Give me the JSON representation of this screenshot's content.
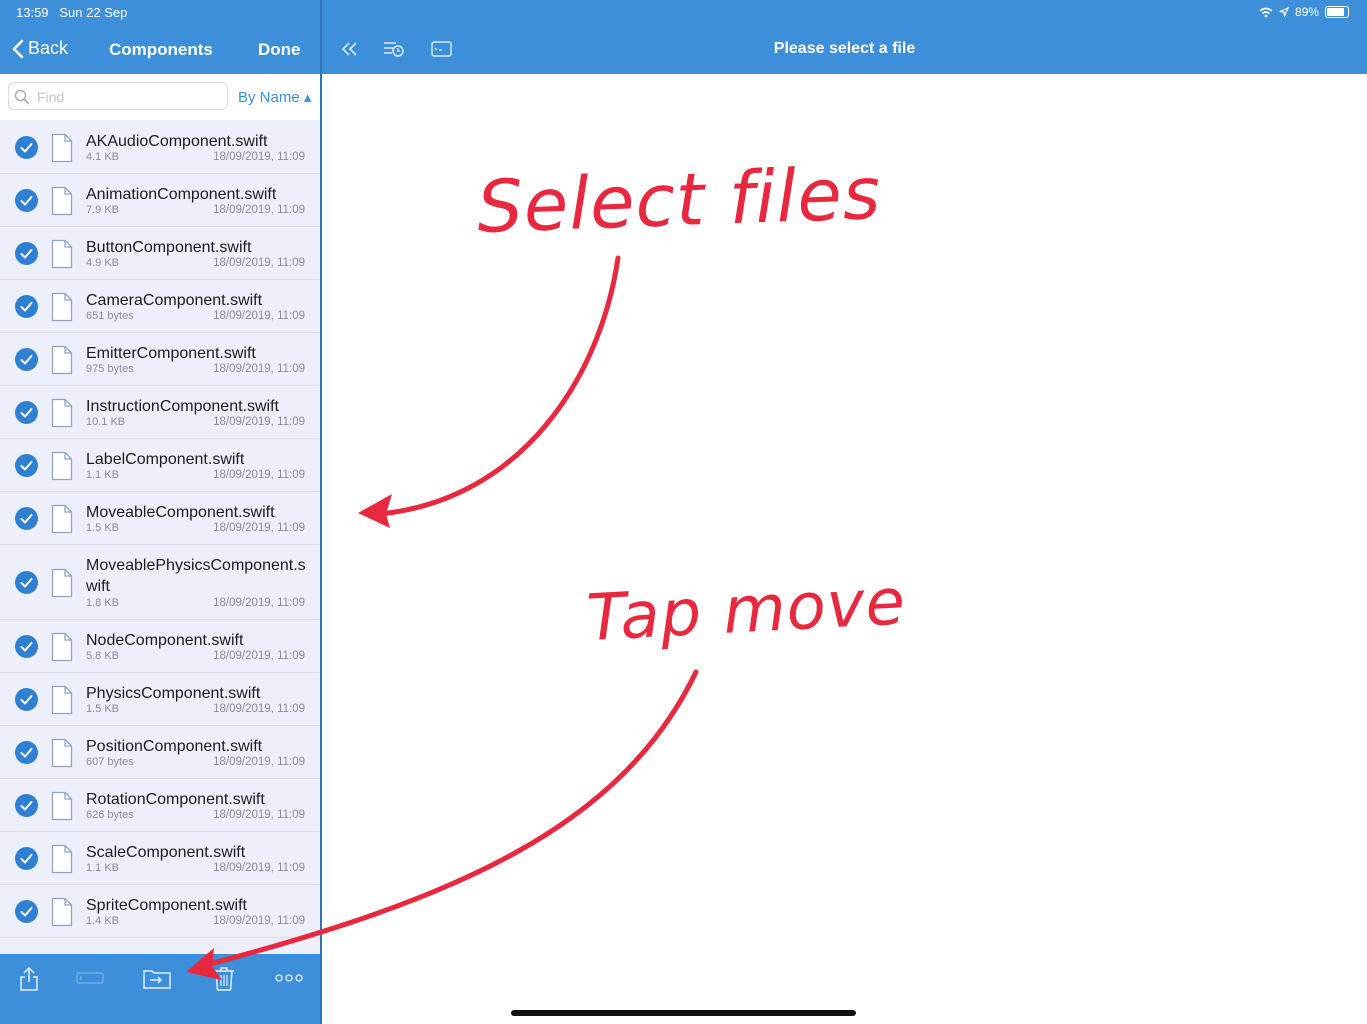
{
  "status": {
    "time": "13:59",
    "date": "Sun 22 Sep",
    "battery": "89%"
  },
  "left_nav": {
    "back_label": "Back",
    "title": "Components",
    "done_label": "Done"
  },
  "right_nav": {
    "title": "Please select a file"
  },
  "search": {
    "placeholder": "Find",
    "value": "",
    "sort_label": "By Name ▴"
  },
  "files": [
    {
      "name": "AKAudioComponent.swift",
      "size": "4.1 KB",
      "date": "18/09/2019, 11:09",
      "selected": true
    },
    {
      "name": "AnimationComponent.swift",
      "size": "7.9 KB",
      "date": "18/09/2019, 11:09",
      "selected": true
    },
    {
      "name": "ButtonComponent.swift",
      "size": "4.9 KB",
      "date": "18/09/2019, 11:09",
      "selected": true
    },
    {
      "name": "CameraComponent.swift",
      "size": "651 bytes",
      "date": "18/09/2019, 11:09",
      "selected": true
    },
    {
      "name": "EmitterComponent.swift",
      "size": "975 bytes",
      "date": "18/09/2019, 11:09",
      "selected": true
    },
    {
      "name": "InstructionComponent.swift",
      "size": "10.1 KB",
      "date": "18/09/2019, 11:09",
      "selected": true
    },
    {
      "name": "LabelComponent.swift",
      "size": "1.1 KB",
      "date": "18/09/2019, 11:09",
      "selected": true
    },
    {
      "name": "MoveableComponent.swift",
      "size": "1.5 KB",
      "date": "18/09/2019, 11:09",
      "selected": true
    },
    {
      "name": "MoveablePhysicsComponent.swift",
      "size": "1.8 KB",
      "date": "18/09/2019, 11:09",
      "selected": true
    },
    {
      "name": "NodeComponent.swift",
      "size": "5.8 KB",
      "date": "18/09/2019, 11:09",
      "selected": true
    },
    {
      "name": "PhysicsComponent.swift",
      "size": "1.5 KB",
      "date": "18/09/2019, 11:09",
      "selected": true
    },
    {
      "name": "PositionComponent.swift",
      "size": "607 bytes",
      "date": "18/09/2019, 11:09",
      "selected": true
    },
    {
      "name": "RotationComponent.swift",
      "size": "626 bytes",
      "date": "18/09/2019, 11:09",
      "selected": true
    },
    {
      "name": "ScaleComponent.swift",
      "size": "1.1 KB",
      "date": "18/09/2019, 11:09",
      "selected": true
    },
    {
      "name": "SpriteComponent.swift",
      "size": "1.4 KB",
      "date": "18/09/2019, 11:09",
      "selected": true
    }
  ],
  "toolbar_icons": [
    "share-icon",
    "rename-icon",
    "move-icon",
    "trash-icon",
    "more-icon"
  ],
  "annotations": {
    "select_files": "Select files",
    "tap_move": "Tap move"
  },
  "colors": {
    "accent": "#3d8fd9",
    "check": "#2f7fd3",
    "annotation": "#e8283f",
    "list_bg": "#edf0fa"
  }
}
